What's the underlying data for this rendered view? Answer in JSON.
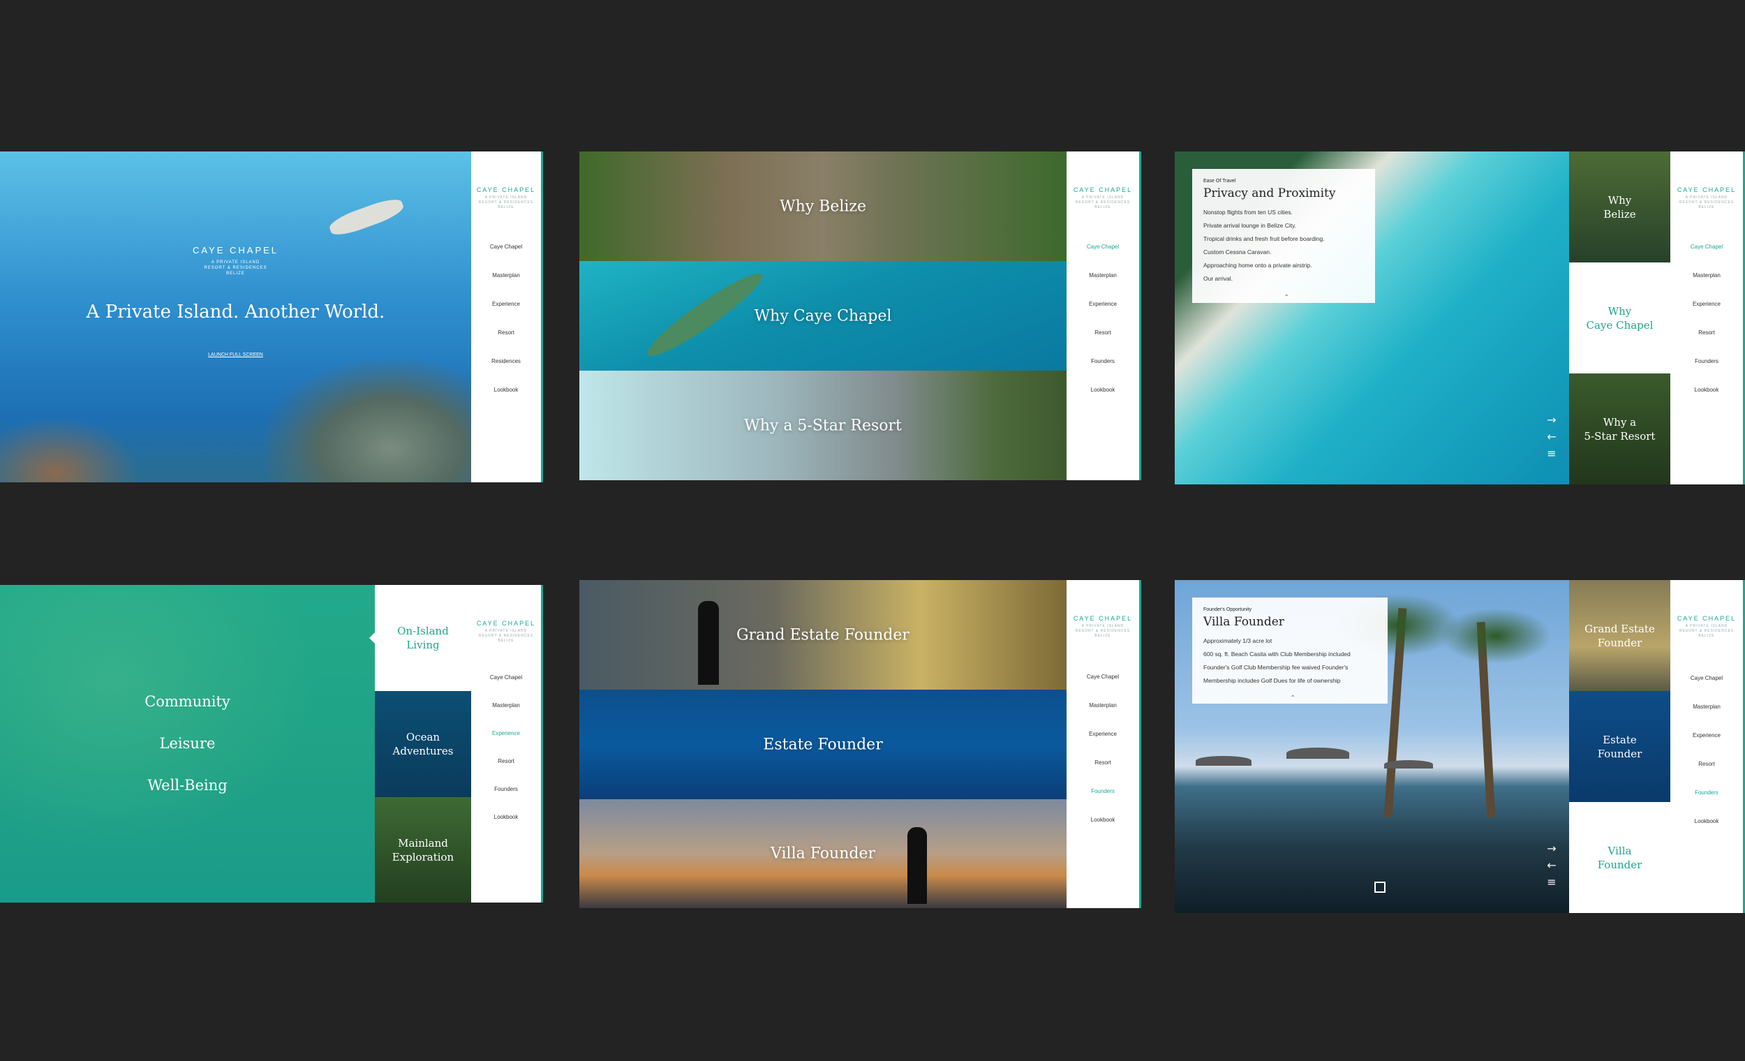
{
  "brand": {
    "name": "CAYE CHAPEL",
    "sub1": "A PRIVATE ISLAND",
    "sub2": "RESORT & RESIDENCES",
    "sub3": "BELIZE"
  },
  "screen1": {
    "hero_title": "A Private Island. Another World.",
    "launch": "LAUNCH FULL SCREEN",
    "menu": [
      "Caye Chapel",
      "Masterplan",
      "Experience",
      "Resort",
      "Residences",
      "Lookbook"
    ]
  },
  "screen2": {
    "bands": [
      "Why Belize",
      "Why Caye Chapel",
      "Why a 5-Star Resort"
    ],
    "menu": [
      "Caye Chapel",
      "Masterplan",
      "Experience",
      "Resort",
      "Founders",
      "Lookbook"
    ],
    "active": "Caye Chapel"
  },
  "screen3": {
    "card": {
      "kicker": "Ease Of Travel",
      "title": "Privacy and Proximity",
      "lines": [
        "Nonstop flights from ten US cities.",
        "Private arrival lounge in Belize City.",
        "Tropical drinks and fresh fruit before boarding.",
        "Custom Cessna Caravan.",
        "Approaching home onto a private airstrip.",
        "Our arrival."
      ]
    },
    "tiles": [
      "Why\nBelize",
      "Why\nCaye Chapel",
      "Why a\n5-Star Resort"
    ],
    "menu": [
      "Caye Chapel",
      "Masterplan",
      "Experience",
      "Resort",
      "Founders",
      "Lookbook"
    ],
    "active": "Caye Chapel"
  },
  "screen4": {
    "items": [
      "Community",
      "Leisure",
      "Well-Being"
    ],
    "tiles": [
      "On-Island\nLiving",
      "Ocean\nAdventures",
      "Mainland\nExploration"
    ],
    "menu": [
      "Caye Chapel",
      "Masterplan",
      "Experience",
      "Resort",
      "Founders",
      "Lookbook"
    ],
    "active": "Experience"
  },
  "screen5": {
    "bands": [
      "Grand Estate Founder",
      "Estate Founder",
      "Villa Founder"
    ],
    "menu": [
      "Caye Chapel",
      "Masterplan",
      "Experience",
      "Resort",
      "Founders",
      "Lookbook"
    ],
    "active": "Founders"
  },
  "screen6": {
    "card": {
      "kicker": "Founder's Opportunity",
      "title": "Villa Founder",
      "lines": [
        "Approximately 1/3 acre lot",
        "600 sq. ft. Beach Casita with Club Membership included",
        "Founder's Golf Club Membership fee waived Founder's",
        "Membership includes Golf Dues for life of ownership"
      ]
    },
    "tiles": [
      "Grand Estate\nFounder",
      "Estate\nFounder",
      "Villa\nFounder"
    ],
    "menu": [
      "Caye Chapel",
      "Masterplan",
      "Experience",
      "Resort",
      "Founders",
      "Lookbook"
    ],
    "active": "Founders"
  },
  "colors": {
    "accent": "#1aa893",
    "background": "#232323"
  }
}
